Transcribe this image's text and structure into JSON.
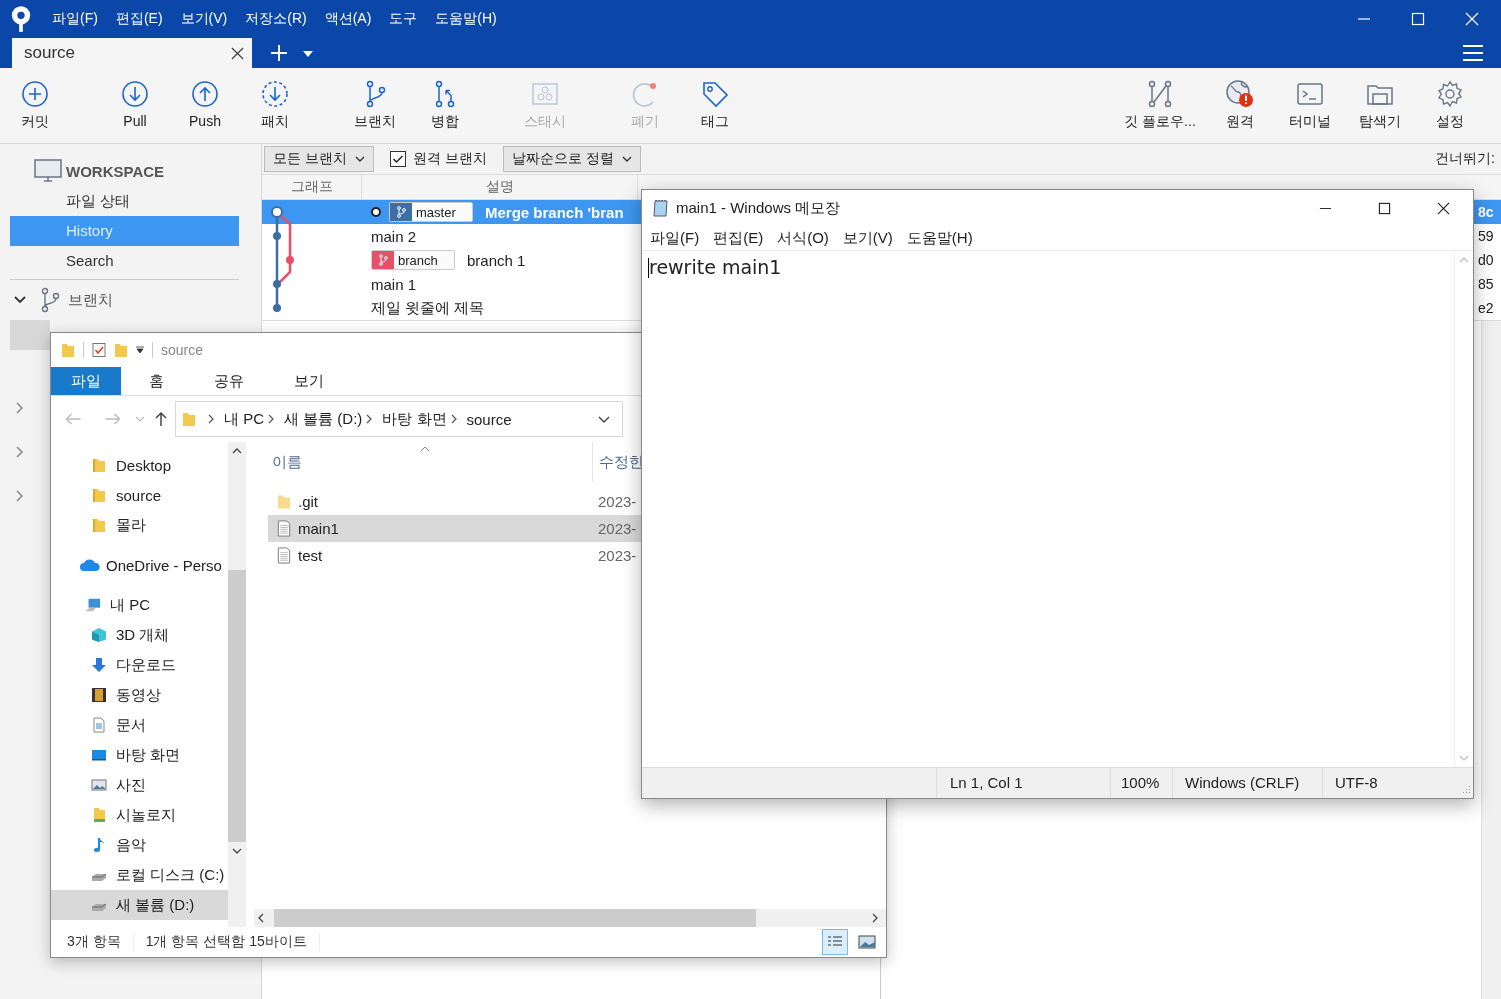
{
  "app": {
    "menu": [
      "파일(F)",
      "편집(E)",
      "보기(V)",
      "저장소(R)",
      "액션(A)",
      "도구",
      "도움말(H)"
    ],
    "tab": {
      "label": "source"
    },
    "toolbar_left": [
      {
        "label": "커밋",
        "kind": "commit",
        "disabled": false
      },
      {
        "label": "Pull",
        "kind": "pull",
        "disabled": false
      },
      {
        "label": "Push",
        "kind": "push",
        "disabled": false
      },
      {
        "label": "패치",
        "kind": "fetch",
        "disabled": false
      },
      {
        "label": "브랜치",
        "kind": "branch",
        "disabled": false
      },
      {
        "label": "병합",
        "kind": "merge",
        "disabled": false
      },
      {
        "label": "스태시",
        "kind": "stash",
        "disabled": true
      },
      {
        "label": "폐기",
        "kind": "discard",
        "disabled": true
      },
      {
        "label": "태그",
        "kind": "tag",
        "disabled": false
      }
    ],
    "toolbar_right": [
      {
        "label": "깃 플로우...",
        "kind": "gitflow",
        "disabled": false
      },
      {
        "label": "원격",
        "kind": "remote",
        "disabled": false
      },
      {
        "label": "터미널",
        "kind": "terminal",
        "disabled": false
      },
      {
        "label": "탐색기",
        "kind": "explorer",
        "disabled": false
      },
      {
        "label": "설정",
        "kind": "settings",
        "disabled": false
      }
    ],
    "sidebar": {
      "workspace": "WORKSPACE",
      "items": [
        {
          "label": "파일 상태",
          "selected": false
        },
        {
          "label": "History",
          "selected": true
        },
        {
          "label": "Search",
          "selected": false
        }
      ],
      "branches": "브랜치"
    },
    "filter": {
      "branch_dropdown": "모든 브랜치",
      "remote_checkbox": {
        "label": "원격 브랜치",
        "checked": true
      },
      "sort_dropdown": "날짜순으로 정렬",
      "jump": "건너뛰기:"
    },
    "columns": [
      "그래프",
      "설명"
    ],
    "commits": [
      {
        "description": "Merge branch 'bran",
        "selected": true,
        "head": true,
        "tag": {
          "label": "master",
          "color": "#3d6fa6"
        },
        "hash": "8c"
      },
      {
        "description": "main 2",
        "selected": false,
        "head": false,
        "hash": "59"
      },
      {
        "description": "branch 1",
        "selected": false,
        "head": false,
        "tag": {
          "label": "branch",
          "color": "#e8506a"
        },
        "hash": "d0"
      },
      {
        "description": "main 1",
        "selected": false,
        "head": false,
        "hash": "85"
      },
      {
        "description": "제일 윗줄에 제목",
        "selected": false,
        "head": false,
        "hash": "e2"
      }
    ]
  },
  "explorer": {
    "title": "source",
    "ribbon_tabs": [
      {
        "label": "파일",
        "selected": true
      },
      {
        "label": "홈",
        "selected": false
      },
      {
        "label": "공유",
        "selected": false
      },
      {
        "label": "보기",
        "selected": false
      }
    ],
    "breadcrumb": [
      "내 PC",
      "새 볼륨 (D:)",
      "바탕 화면",
      "source"
    ],
    "nav_tree": [
      {
        "label": "Desktop",
        "kind": "folder",
        "selected": false
      },
      {
        "label": "source",
        "kind": "folder",
        "selected": false
      },
      {
        "label": "몰라",
        "kind": "folder",
        "selected": false
      },
      {
        "label": "OneDrive - Perso",
        "kind": "cloud",
        "selected": false
      },
      {
        "label": "내 PC",
        "kind": "pc",
        "selected": false,
        "children": [
          {
            "label": "3D 개체",
            "kind": "cube",
            "selected": false
          },
          {
            "label": "다운로드",
            "kind": "download",
            "selected": false
          },
          {
            "label": "동영상",
            "kind": "film",
            "selected": false
          },
          {
            "label": "문서",
            "kind": "doc",
            "selected": false
          },
          {
            "label": "바탕 화면",
            "kind": "desktop",
            "selected": false
          },
          {
            "label": "사진",
            "kind": "photo",
            "selected": false
          },
          {
            "label": "시놀로지",
            "kind": "nas",
            "selected": false
          },
          {
            "label": "음악",
            "kind": "music",
            "selected": false
          },
          {
            "label": "로컬 디스크 (C:)",
            "kind": "drive",
            "selected": false
          },
          {
            "label": "새 볼륨 (D:)",
            "kind": "drive",
            "selected": true
          }
        ]
      }
    ],
    "columns": [
      "이름",
      "수정한"
    ],
    "files": [
      {
        "name": ".git",
        "date": "2023-",
        "kind": "folder",
        "selected": false
      },
      {
        "name": "main1",
        "date": "2023-",
        "kind": "file",
        "selected": true
      },
      {
        "name": "test",
        "date": "2023-",
        "kind": "file",
        "selected": false
      }
    ],
    "status": [
      "3개 항목",
      "1개 항목 선택함 15바이트"
    ],
    "views": [
      {
        "kind": "details",
        "selected": true
      },
      {
        "kind": "thumbnails",
        "selected": false
      }
    ]
  },
  "notepad": {
    "title": "main1 - Windows 메모장",
    "menu": [
      "파일(F)",
      "편집(E)",
      "서식(O)",
      "보기(V)",
      "도움말(H)"
    ],
    "content": "rewrite main1",
    "status": [
      "Ln 1, Col 1",
      "100%",
      "Windows (CRLF)",
      "UTF-8"
    ]
  }
}
